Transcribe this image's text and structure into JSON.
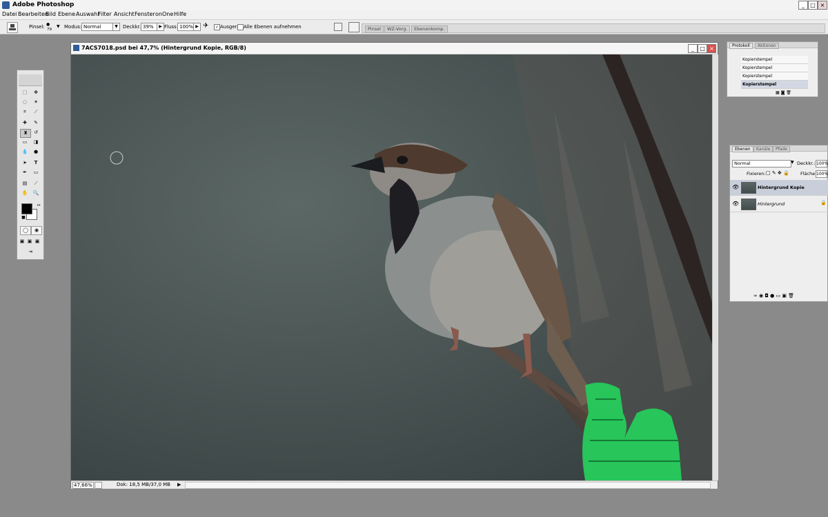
{
  "window": {
    "title": "Adobe Photoshop",
    "buttons": [
      "_",
      "□",
      "×"
    ]
  },
  "menu": [
    "Datei",
    "Bearbeiten",
    "Bild",
    "Ebene",
    "Auswahl",
    "Filter",
    "Ansicht",
    "Fenster",
    "onOne",
    "Hilfe"
  ],
  "options": {
    "pinsel_label": "Pinsel:",
    "brush_size": "79",
    "modus_label": "Modus:",
    "modus_value": "Normal",
    "deckkr_label": "Deckkr.:",
    "deckkr_value": "39%",
    "fluss_label": "Fluss:",
    "fluss_value": "100%",
    "ausger_label": "Ausger.",
    "alle_ebenen_label": "Alle Ebenen aufnehmen",
    "palette_tabs": [
      "Pinsel",
      "WZ-Vorg.",
      "Ebenenkomp."
    ]
  },
  "document": {
    "title": "7ACS7018.psd bei 47,7% (Hintergrund Kopie, RGB/8)",
    "zoom": "47,66%",
    "doc_info": "Dok: 18,5 MB/37,0 MB"
  },
  "history_panel": {
    "tabs": [
      "Protokoll",
      "Aktionen"
    ],
    "items": [
      "Kopierstempel",
      "Kopierstempel",
      "Kopierstempel",
      "Kopierstempel"
    ]
  },
  "layers_panel": {
    "tabs": [
      "Ebenen",
      "Kanäle",
      "Pfade"
    ],
    "blend_mode": "Normal",
    "deckkr_label": "Deckkr.:",
    "deckkr_value": "100%",
    "fixieren_label": "Fixieren:",
    "flaeche_label": "Fläche:",
    "flaeche_value": "100%",
    "layers": [
      "Hintergrund Kopie",
      "Hintergrund"
    ]
  }
}
